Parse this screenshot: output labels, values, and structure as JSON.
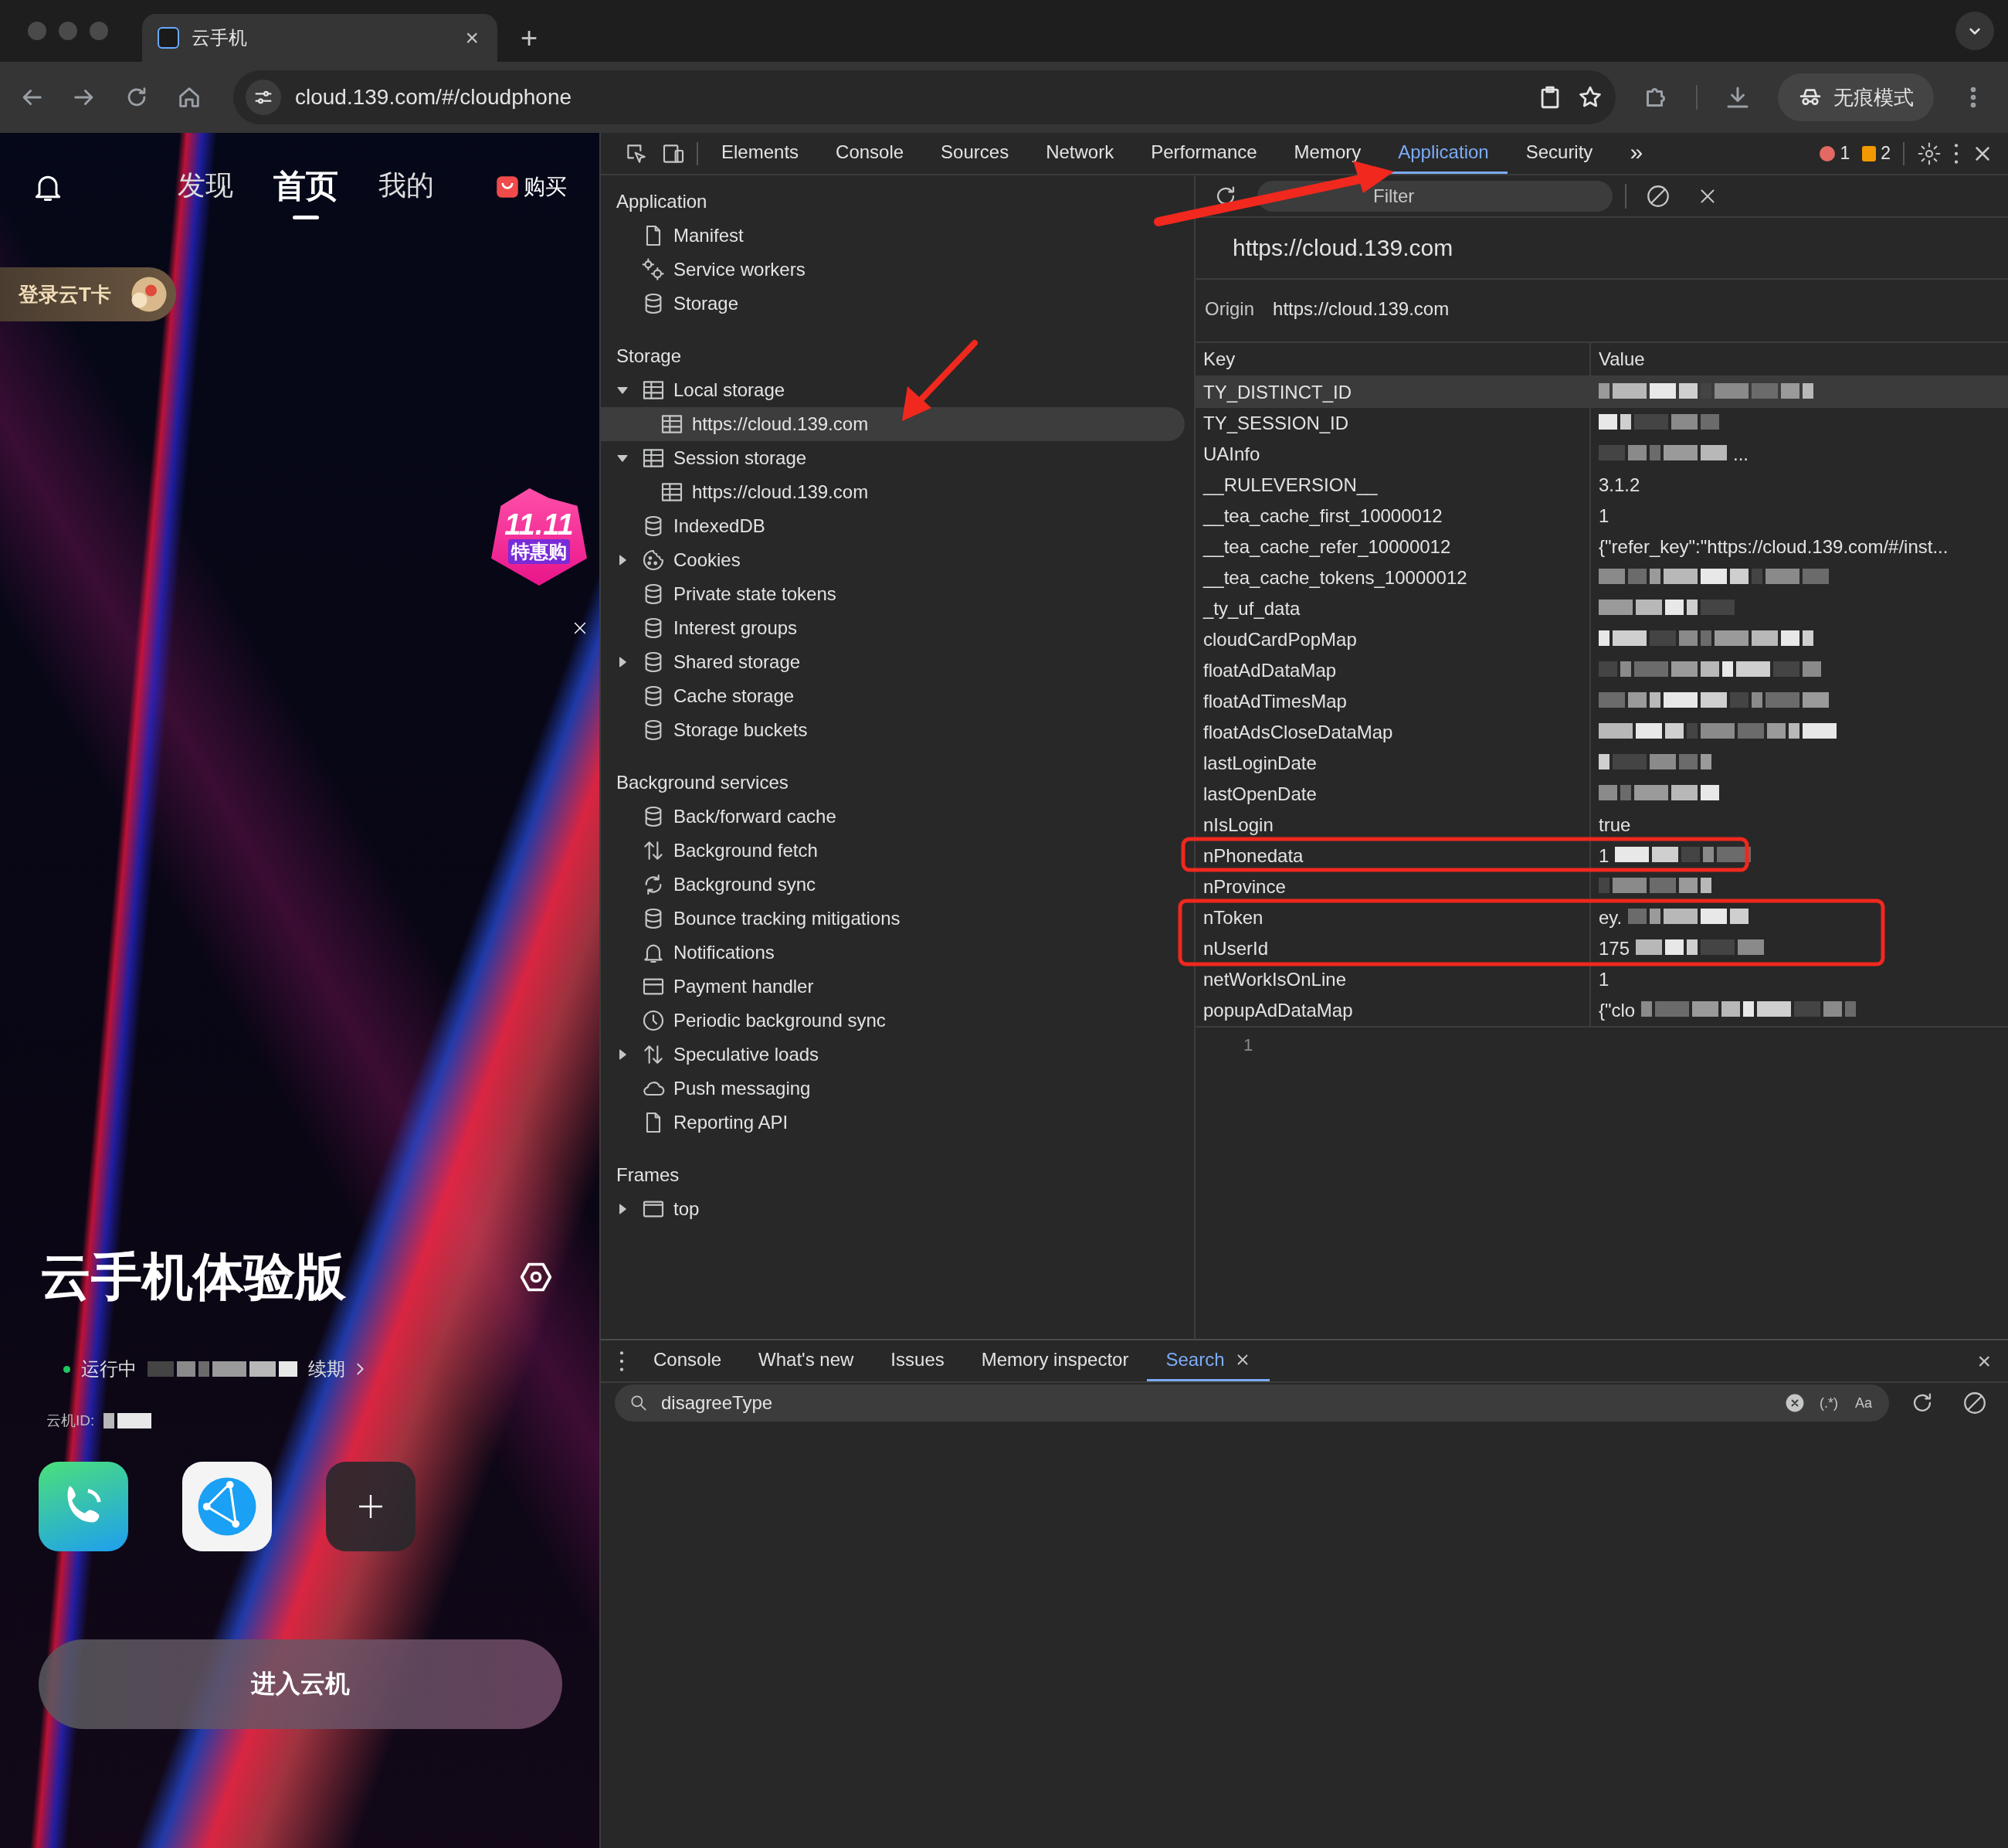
{
  "browser": {
    "tab": {
      "title": "云手机",
      "close": "×"
    },
    "new_tab": "+",
    "address": "cloud.139.com/#/cloudphone",
    "profile": "无痕模式"
  },
  "app": {
    "nav": [
      {
        "label": "发现",
        "selected": false
      },
      {
        "label": "首页",
        "selected": true
      },
      {
        "label": "我的",
        "selected": false
      }
    ],
    "buy": "购买",
    "login_card": "登录云T卡",
    "promo": {
      "title": "11.11",
      "subtitle": "特惠购"
    },
    "title": "云手机体验版",
    "status": {
      "text": "运行中",
      "running": true,
      "renew": "续期"
    },
    "cloud_id_label": "云机ID:",
    "enter_button": "进入云机"
  },
  "devtools": {
    "tabs": [
      {
        "label": "Elements",
        "selected": false
      },
      {
        "label": "Console",
        "selected": false
      },
      {
        "label": "Sources",
        "selected": false
      },
      {
        "label": "Network",
        "selected": false
      },
      {
        "label": "Performance",
        "selected": false
      },
      {
        "label": "Memory",
        "selected": false
      },
      {
        "label": "Application",
        "selected": true
      },
      {
        "label": "Security",
        "selected": false
      }
    ],
    "more_tabs": "»",
    "errors": "1",
    "warnings": "2",
    "sidebar": [
      {
        "title": "Application",
        "items": [
          {
            "label": "Manifest",
            "kind": "file",
            "selected": false
          },
          {
            "label": "Service workers",
            "kind": "gears",
            "selected": false
          },
          {
            "label": "Storage",
            "kind": "db",
            "selected": false
          }
        ]
      },
      {
        "title": "Storage",
        "items": [
          {
            "label": "Local storage",
            "kind": "table",
            "selected": false,
            "expanded": true,
            "children": [
              {
                "label": "https://cloud.139.com",
                "kind": "table",
                "selected": true
              }
            ]
          },
          {
            "label": "Session storage",
            "kind": "table",
            "selected": false,
            "expanded": true,
            "children": [
              {
                "label": "https://cloud.139.com",
                "kind": "table",
                "selected": false
              }
            ]
          },
          {
            "label": "IndexedDB",
            "kind": "db",
            "selected": false
          },
          {
            "label": "Cookies",
            "kind": "cookie",
            "selected": false,
            "expanded": false
          },
          {
            "label": "Private state tokens",
            "kind": "db",
            "selected": false
          },
          {
            "label": "Interest groups",
            "kind": "db",
            "selected": false
          },
          {
            "label": "Shared storage",
            "kind": "db",
            "selected": false,
            "expanded": false
          },
          {
            "label": "Cache storage",
            "kind": "db",
            "selected": false
          },
          {
            "label": "Storage buckets",
            "kind": "db",
            "selected": false
          }
        ]
      },
      {
        "title": "Background services",
        "items": [
          {
            "label": "Back/forward cache",
            "kind": "db",
            "selected": false
          },
          {
            "label": "Background fetch",
            "kind": "updown",
            "selected": false
          },
          {
            "label": "Background sync",
            "kind": "sync",
            "selected": false
          },
          {
            "label": "Bounce tracking mitigations",
            "kind": "db",
            "selected": false
          },
          {
            "label": "Notifications",
            "kind": "bell",
            "selected": false
          },
          {
            "label": "Payment handler",
            "kind": "card",
            "selected": false
          },
          {
            "label": "Periodic background sync",
            "kind": "clock",
            "selected": false
          },
          {
            "label": "Speculative loads",
            "kind": "updown",
            "selected": false,
            "expanded": false
          },
          {
            "label": "Push messaging",
            "kind": "cloud",
            "selected": false
          },
          {
            "label": "Reporting API",
            "kind": "file",
            "selected": false
          }
        ]
      },
      {
        "title": "Frames",
        "items": [
          {
            "label": "top",
            "kind": "frame",
            "selected": false,
            "expanded": false
          }
        ]
      }
    ],
    "filter": {
      "placeholder": "Filter"
    },
    "storage_title": "https://cloud.139.com",
    "origin": {
      "label": "Origin",
      "value": "https://cloud.139.com"
    },
    "table": {
      "columns": [
        "Key",
        "Value"
      ],
      "rows": [
        {
          "key": "TY_DISTINCT_ID",
          "redacted": true,
          "selected": true
        },
        {
          "key": "TY_SESSION_ID",
          "redacted": true,
          "selected": false
        },
        {
          "key": "UAInfo",
          "redacted": true,
          "tail": "...",
          "selected": false
        },
        {
          "key": "__RULEVERSION__",
          "value": "3.1.2",
          "redacted": false,
          "selected": false
        },
        {
          "key": "__tea_cache_first_10000012",
          "value": "1",
          "redacted": false,
          "selected": false
        },
        {
          "key": "__tea_cache_refer_10000012",
          "value": "{\"refer_key\":\"https://cloud.139.com/#/inst...",
          "redacted": false,
          "selected": false
        },
        {
          "key": "__tea_cache_tokens_10000012",
          "redacted": true,
          "selected": false
        },
        {
          "key": "_ty_uf_data",
          "redacted": true,
          "selected": false
        },
        {
          "key": "cloudCardPopMap",
          "redacted": true,
          "selected": false
        },
        {
          "key": "floatAdDataMap",
          "redacted": true,
          "selected": false
        },
        {
          "key": "floatAdTimesMap",
          "redacted": true,
          "selected": false
        },
        {
          "key": "floatAdsCloseDataMap",
          "redacted": true,
          "selected": false
        },
        {
          "key": "lastLoginDate",
          "redacted": true,
          "selected": false
        },
        {
          "key": "lastOpenDate",
          "redacted": true,
          "selected": false
        },
        {
          "key": "nIsLogin",
          "value": "true",
          "redacted": false,
          "selected": false
        },
        {
          "key": "nPhonedata",
          "value": "1",
          "redacted": true,
          "selected": false
        },
        {
          "key": "nProvince",
          "redacted": true,
          "selected": false
        },
        {
          "key": "nToken",
          "value": "ey.",
          "redacted": true,
          "selected": false
        },
        {
          "key": "nUserId",
          "value": "175",
          "redacted": true,
          "selected": false
        },
        {
          "key": "netWorkIsOnLine",
          "value": "1",
          "redacted": false,
          "selected": false
        },
        {
          "key": "popupAdDataMap",
          "value": "{\"clo",
          "redacted": true,
          "selected": false
        }
      ]
    },
    "preview_line": "1",
    "drawer": {
      "tabs": [
        {
          "label": "Console",
          "selected": false
        },
        {
          "label": "What's new",
          "selected": false
        },
        {
          "label": "Issues",
          "selected": false
        },
        {
          "label": "Memory inspector",
          "selected": false
        },
        {
          "label": "Search",
          "selected": true,
          "closable": true
        }
      ],
      "close": "×",
      "search_value": "disagreeType",
      "regex_toggle": "(.*)",
      "case_toggle": "Aa"
    }
  }
}
